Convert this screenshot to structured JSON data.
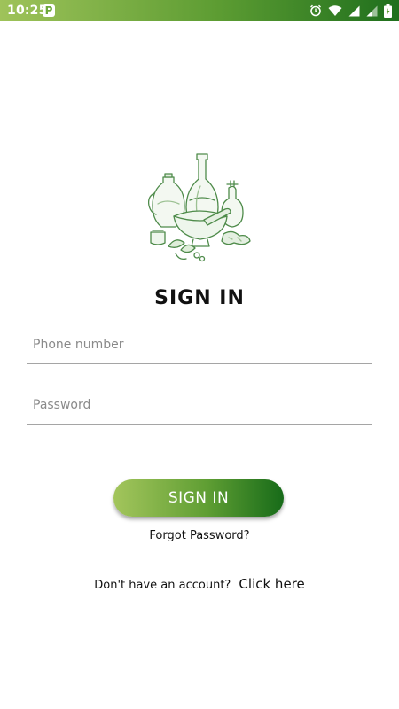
{
  "status_bar": {
    "time": "10:25",
    "app_badge": "P",
    "icons": [
      "alarm-icon",
      "wifi-icon",
      "signal-icon",
      "signal-icon-2",
      "battery-icon"
    ]
  },
  "colors": {
    "gradient_start": "#a3c55c",
    "gradient_end": "#176b19",
    "illustration_green": "#4e8b4a"
  },
  "illustration": {
    "icon": "herbal-jars-mortar-illustration"
  },
  "form": {
    "title": "SIGN IN",
    "phone_placeholder": "Phone number",
    "password_placeholder": "Password",
    "submit_label": "SIGN IN",
    "forgot_label": "Forgot Password?",
    "signup_question": "Don't have an account?",
    "signup_link": "Click here"
  }
}
